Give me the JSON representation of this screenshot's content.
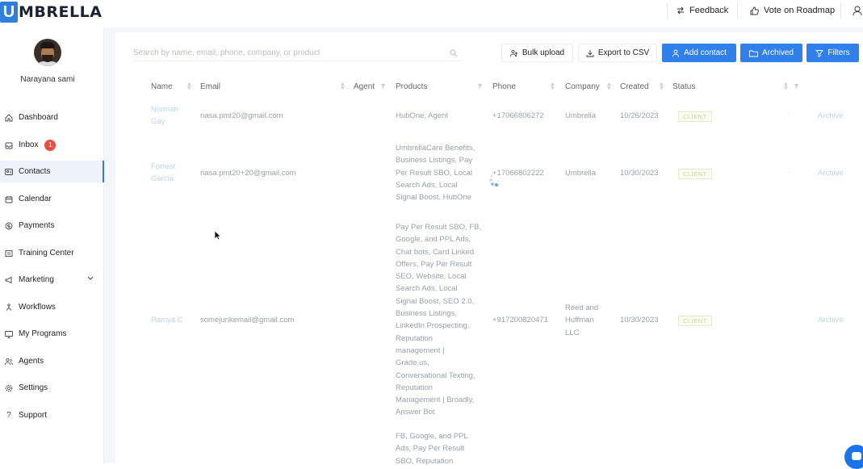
{
  "app": {
    "logo_letter": "U",
    "logo_text": "MBRELLA"
  },
  "topbar": {
    "feedback_label": "Feedback",
    "roadmap_label": "Vote on Roadmap"
  },
  "user": {
    "name": "Narayana sami"
  },
  "sidebar": {
    "items": [
      {
        "label": "Dashboard",
        "icon": "home-icon"
      },
      {
        "label": "Inbox",
        "icon": "inbox-icon",
        "badge": "1"
      },
      {
        "label": "Contacts",
        "icon": "contacts-icon",
        "active": true
      },
      {
        "label": "Calendar",
        "icon": "calendar-icon"
      },
      {
        "label": "Payments",
        "icon": "payments-icon"
      },
      {
        "label": "Training Center",
        "icon": "training-icon"
      },
      {
        "label": "Marketing",
        "icon": "megaphone-icon",
        "expandable": true
      },
      {
        "label": "Workflows",
        "icon": "workflow-icon"
      },
      {
        "label": "My Programs",
        "icon": "monitor-icon"
      },
      {
        "label": "Agents",
        "icon": "agents-icon"
      },
      {
        "label": "Settings",
        "icon": "gear-icon"
      },
      {
        "label": "Support",
        "icon": "question-icon"
      }
    ]
  },
  "toolbar": {
    "search_placeholder": "Search by name, email, phone, company, or product",
    "bulk_upload_label": "Bulk upload",
    "export_label": "Export to CSV",
    "add_contact_label": "Add contact",
    "archived_label": "Archived",
    "filters_label": "Filters"
  },
  "table": {
    "columns": [
      "Name",
      "Email",
      "Agent",
      "Products",
      "Phone",
      "Company",
      "Created",
      "Status"
    ],
    "rows": [
      {
        "name": [
          "Norman",
          "Gay"
        ],
        "email": "nasa.pmt20@gmail.com",
        "products": [
          "HubOne, Agent"
        ],
        "phone": "+17066806272",
        "company": [
          "Umbrella"
        ],
        "created": "10/26/2023",
        "status": "CLIENT",
        "action": "Archive"
      },
      {
        "name": [
          "Forrest",
          "Garcia"
        ],
        "email": "nasa.pmt20+20@gmail.com",
        "products": [
          "UmbrellaCare Benefits,",
          "Business Listings, Pay",
          "Per Result SBO, Local",
          "Search Ads, Local",
          "Signal Boost, HubOne"
        ],
        "phone": "+17066802222",
        "company": [
          "Umbrella"
        ],
        "created": "10/30/2023",
        "status": "CLIENT",
        "action": "Archive"
      },
      {
        "name": [
          "Ramya C"
        ],
        "email": "somejunkemail@gmail.com",
        "products": [
          "Pay Per Result SBO, FB,",
          "Google, and PPL Ads,",
          "Chat bots, Card Linked",
          "Offers, Pay Per Result",
          "SEO, Website, Local",
          "Search Ads, Local",
          "Signal Boost, SEO 2.0,",
          "Business Listings,",
          "LinkedIn Prospecting,",
          "Reputation",
          "management |",
          "Grade.us,",
          "Conversational Texting,",
          "Reputation",
          "Management | Broadly,",
          "Answer Bot"
        ],
        "phone": "+917200820471",
        "company": [
          "Reed and",
          "Huffman",
          "LLC"
        ],
        "created": "10/30/2023",
        "status": "CLIENT",
        "action": "Archive"
      },
      {
        "name": [
          ""
        ],
        "email": "",
        "products": [
          "FB, Google, and PPL",
          "Ads, Pay Per Result",
          "SBO, Reputation"
        ],
        "phone": "",
        "company": [
          ""
        ],
        "created": "",
        "status": "",
        "action": ""
      }
    ]
  },
  "colors": {
    "primary": "#2f80ed",
    "badge": "#ef4b3f",
    "client_tag": "#c2d88a"
  }
}
